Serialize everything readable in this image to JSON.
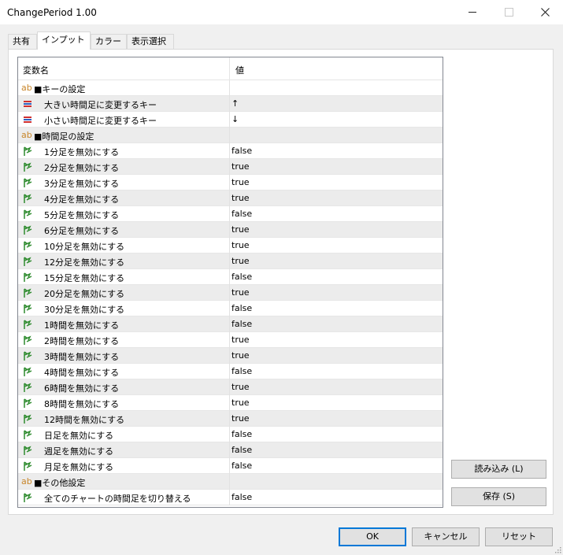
{
  "window": {
    "title": "ChangePeriod 1.00"
  },
  "tabs": [
    {
      "label": "共有",
      "active": false
    },
    {
      "label": "インプット",
      "active": true
    },
    {
      "label": "カラー",
      "active": false
    },
    {
      "label": "表示選択",
      "active": false
    }
  ],
  "grid": {
    "header_name": "変数名",
    "header_value": "値",
    "rows": [
      {
        "type": "section",
        "icon": "ab",
        "name": "■キーの設定",
        "value": ""
      },
      {
        "type": "key",
        "icon": "key-icon",
        "name": "大きい時間足に変更するキー",
        "value": "↑"
      },
      {
        "type": "key",
        "icon": "key-icon",
        "name": "小さい時間足に変更するキー",
        "value": "↓"
      },
      {
        "type": "section",
        "icon": "ab",
        "name": "■時間足の設定",
        "value": ""
      },
      {
        "type": "bool",
        "icon": "bool-icon",
        "name": "1分足を無効にする",
        "value": "false"
      },
      {
        "type": "bool",
        "icon": "bool-icon",
        "name": "2分足を無効にする",
        "value": "true"
      },
      {
        "type": "bool",
        "icon": "bool-icon",
        "name": "3分足を無効にする",
        "value": "true"
      },
      {
        "type": "bool",
        "icon": "bool-icon",
        "name": "4分足を無効にする",
        "value": "true"
      },
      {
        "type": "bool",
        "icon": "bool-icon",
        "name": "5分足を無効にする",
        "value": "false"
      },
      {
        "type": "bool",
        "icon": "bool-icon",
        "name": "6分足を無効にする",
        "value": "true"
      },
      {
        "type": "bool",
        "icon": "bool-icon",
        "name": "10分足を無効にする",
        "value": "true"
      },
      {
        "type": "bool",
        "icon": "bool-icon",
        "name": "12分足を無効にする",
        "value": "true"
      },
      {
        "type": "bool",
        "icon": "bool-icon",
        "name": "15分足を無効にする",
        "value": "false"
      },
      {
        "type": "bool",
        "icon": "bool-icon",
        "name": "20分足を無効にする",
        "value": "true"
      },
      {
        "type": "bool",
        "icon": "bool-icon",
        "name": "30分足を無効にする",
        "value": "false"
      },
      {
        "type": "bool",
        "icon": "bool-icon",
        "name": "1時間を無効にする",
        "value": "false"
      },
      {
        "type": "bool",
        "icon": "bool-icon",
        "name": "2時間を無効にする",
        "value": "true"
      },
      {
        "type": "bool",
        "icon": "bool-icon",
        "name": "3時間を無効にする",
        "value": "true"
      },
      {
        "type": "bool",
        "icon": "bool-icon",
        "name": "4時間を無効にする",
        "value": "false"
      },
      {
        "type": "bool",
        "icon": "bool-icon",
        "name": "6時間を無効にする",
        "value": "true"
      },
      {
        "type": "bool",
        "icon": "bool-icon",
        "name": "8時間を無効にする",
        "value": "true"
      },
      {
        "type": "bool",
        "icon": "bool-icon",
        "name": "12時間を無効にする",
        "value": "true"
      },
      {
        "type": "bool",
        "icon": "bool-icon",
        "name": "日足を無効にする",
        "value": "false"
      },
      {
        "type": "bool",
        "icon": "bool-icon",
        "name": "週足を無効にする",
        "value": "false"
      },
      {
        "type": "bool",
        "icon": "bool-icon",
        "name": "月足を無効にする",
        "value": "false"
      },
      {
        "type": "section",
        "icon": "ab",
        "name": "■その他設定",
        "value": ""
      },
      {
        "type": "bool",
        "icon": "bool-icon",
        "name": "全てのチャートの時間足を切り替える",
        "value": "false"
      }
    ]
  },
  "side_buttons": {
    "load": "読み込み (L)",
    "save": "保存 (S)"
  },
  "bottom_buttons": {
    "ok": "OK",
    "cancel": "キャンセル",
    "reset": "リセット"
  },
  "colors": {
    "accent": "#0078d7",
    "section_icon": "#c8862a",
    "bool_icon": "#2e8b2e",
    "key_icon_red": "#d03030",
    "key_icon_blue": "#3060c0"
  }
}
